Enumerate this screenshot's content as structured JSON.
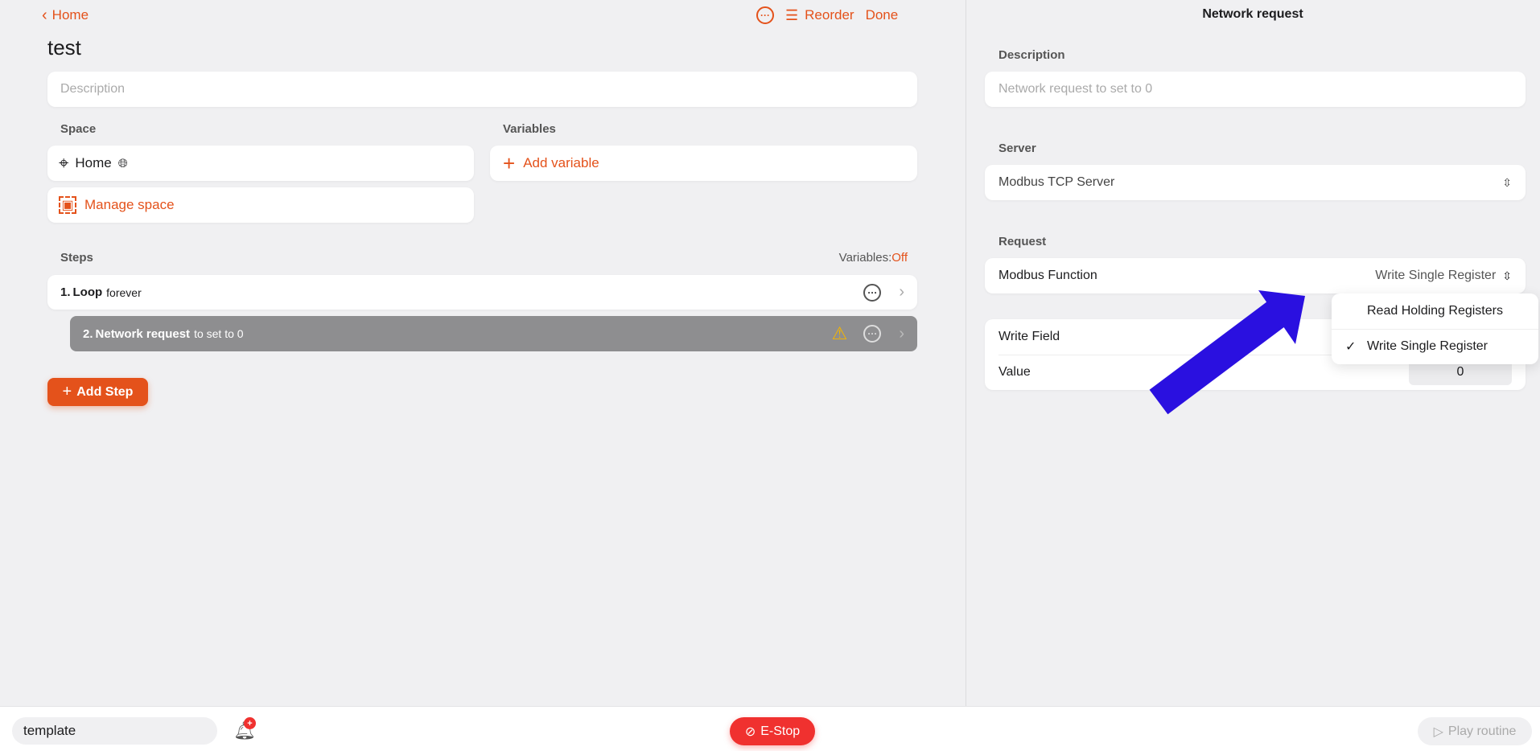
{
  "header": {
    "back_label": "Home",
    "reorder_label": "Reorder",
    "done_label": "Done",
    "title": "test"
  },
  "routine": {
    "description_placeholder": "Description",
    "space_label": "Space",
    "space_value": "Home",
    "variables_label": "Variables",
    "add_variable_label": "Add variable",
    "manage_space_label": "Manage space",
    "steps_label": "Steps",
    "variables_toggle_label": "Variables:",
    "variables_toggle_value": "Off",
    "steps": [
      {
        "number": "1.",
        "name": "Loop",
        "detail": "forever"
      },
      {
        "number": "2.",
        "name": "Network request",
        "detail": "to set to 0",
        "warning": true
      }
    ],
    "add_step_label": "Add Step"
  },
  "panel": {
    "title": "Network request",
    "description_label": "Description",
    "description_placeholder": "Network request to set  to 0",
    "server_label": "Server",
    "server_value": "Modbus TCP Server",
    "request_label": "Request",
    "function_label": "Modbus Function",
    "function_value": "Write Single Register",
    "write_field_label": "Write Field",
    "value_label": "Value",
    "value": "0",
    "dropdown": {
      "options": [
        {
          "label": "Read Holding Registers",
          "selected": false
        },
        {
          "label": "Write Single Register",
          "selected": true
        }
      ]
    }
  },
  "footer": {
    "template_label": "template",
    "estop_label": "E-Stop",
    "play_label": "Play routine",
    "notification_badge": "+"
  },
  "colors": {
    "accent": "#e4521b",
    "estop": "#f0312f",
    "arrow": "#2a10e0",
    "selected_step": "#8e8e90"
  }
}
